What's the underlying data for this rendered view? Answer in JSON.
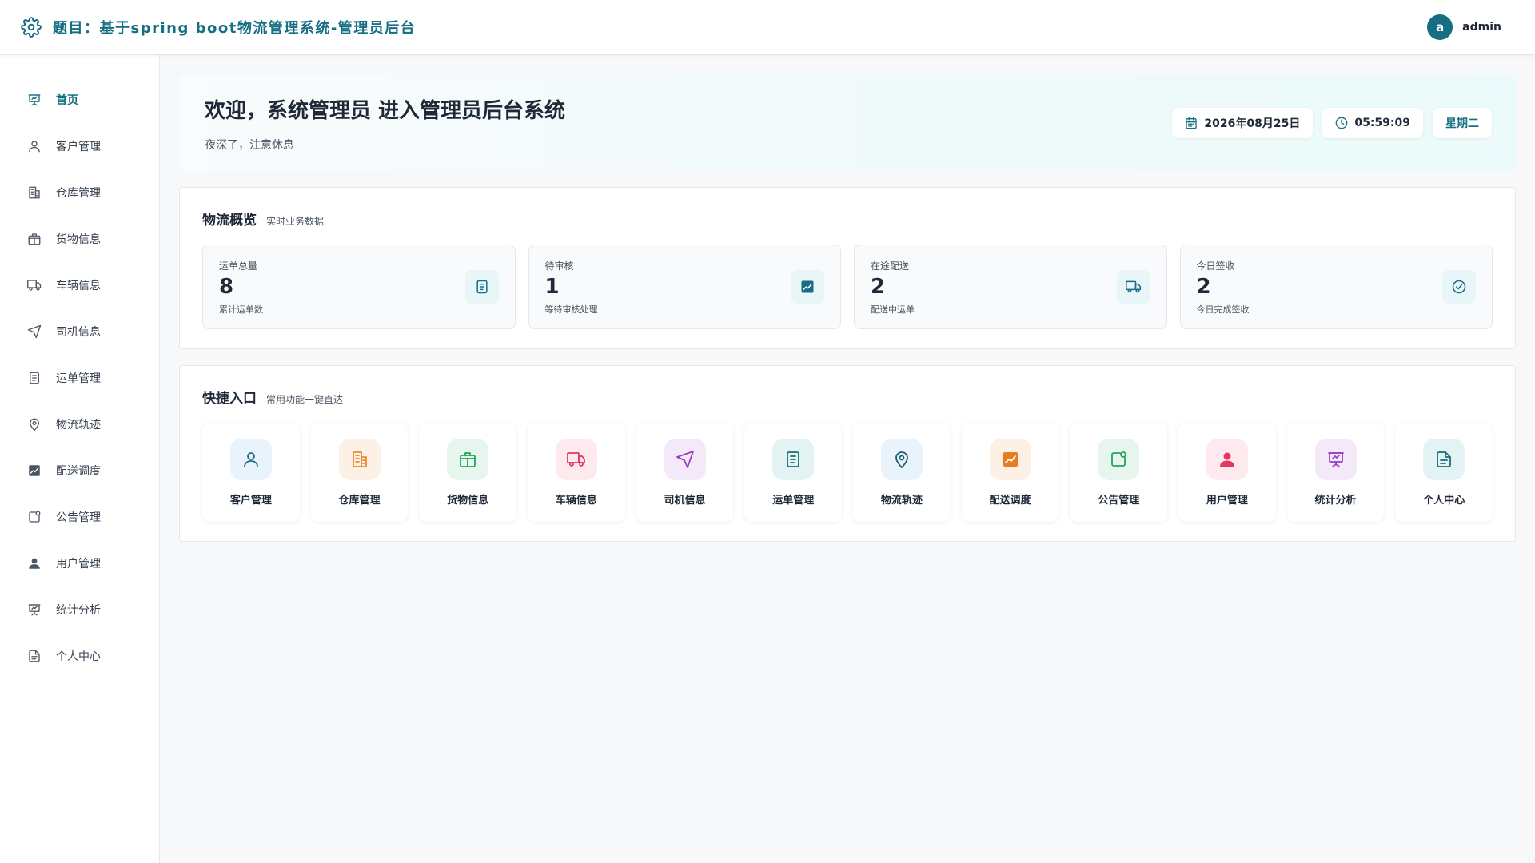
{
  "header": {
    "title": "题目：基于spring boot物流管理系统-管理员后台",
    "avatar_letter": "a",
    "username": "admin"
  },
  "sidebar": {
    "items": [
      {
        "label": "首页",
        "icon": "presentation-icon",
        "active": true
      },
      {
        "label": "客户管理",
        "icon": "user-icon"
      },
      {
        "label": "仓库管理",
        "icon": "building-icon"
      },
      {
        "label": "货物信息",
        "icon": "package-icon"
      },
      {
        "label": "车辆信息",
        "icon": "truck-icon"
      },
      {
        "label": "司机信息",
        "icon": "send-icon"
      },
      {
        "label": "运单管理",
        "icon": "document-icon"
      },
      {
        "label": "物流轨迹",
        "icon": "map-pin-icon"
      },
      {
        "label": "配送调度",
        "icon": "chart-icon"
      },
      {
        "label": "公告管理",
        "icon": "notice-icon"
      },
      {
        "label": "用户管理",
        "icon": "user-solid-icon"
      },
      {
        "label": "统计分析",
        "icon": "presentation-icon"
      },
      {
        "label": "个人中心",
        "icon": "file-icon"
      }
    ]
  },
  "welcome": {
    "title": "欢迎，系统管理员 进入管理员后台系统",
    "subtitle": "夜深了，注意休息",
    "date": "2026年08月25日",
    "time": "05:59:09",
    "weekday": "星期二"
  },
  "overview": {
    "title": "物流概览",
    "subtitle": "实时业务数据",
    "stats": [
      {
        "label": "运单总量",
        "value": "8",
        "desc": "累计运单数",
        "icon": "document-icon"
      },
      {
        "label": "待审核",
        "value": "1",
        "desc": "等待审核处理",
        "icon": "chart-icon"
      },
      {
        "label": "在途配送",
        "value": "2",
        "desc": "配送中运单",
        "icon": "truck-icon"
      },
      {
        "label": "今日签收",
        "value": "2",
        "desc": "今日完成签收",
        "icon": "check-circle-icon"
      }
    ]
  },
  "quick": {
    "title": "快捷入口",
    "subtitle": "常用功能一键直达",
    "items": [
      {
        "label": "客户管理",
        "icon": "user-icon",
        "bg": "#e8f3fb",
        "color": "#1e6b82"
      },
      {
        "label": "仓库管理",
        "icon": "building-icon",
        "bg": "#fdf0e4",
        "color": "#e98a2d"
      },
      {
        "label": "货物信息",
        "icon": "package-icon",
        "bg": "#e6f6ee",
        "color": "#22a559"
      },
      {
        "label": "车辆信息",
        "icon": "truck-icon",
        "bg": "#fde9ee",
        "color": "#e53561"
      },
      {
        "label": "司机信息",
        "icon": "send-icon",
        "bg": "#f4e9f9",
        "color": "#9b3cc3"
      },
      {
        "label": "运单管理",
        "icon": "document-icon",
        "bg": "#e3f2f2",
        "color": "#1b6f78"
      },
      {
        "label": "物流轨迹",
        "icon": "map-pin-icon",
        "bg": "#e8f3fb",
        "color": "#1e5e72"
      },
      {
        "label": "配送调度",
        "icon": "chart-icon",
        "bg": "#fdf0e4",
        "color": "#e67d22"
      },
      {
        "label": "公告管理",
        "icon": "notice-icon",
        "bg": "#e6f6ee",
        "color": "#22a559"
      },
      {
        "label": "用户管理",
        "icon": "user-solid-icon",
        "bg": "#fde9ee",
        "color": "#e53561"
      },
      {
        "label": "统计分析",
        "icon": "presentation-icon",
        "bg": "#f4e9f9",
        "color": "#9b3cc3"
      },
      {
        "label": "个人中心",
        "icon": "file-icon",
        "bg": "#e3f2f2",
        "color": "#1b6f78"
      }
    ]
  }
}
